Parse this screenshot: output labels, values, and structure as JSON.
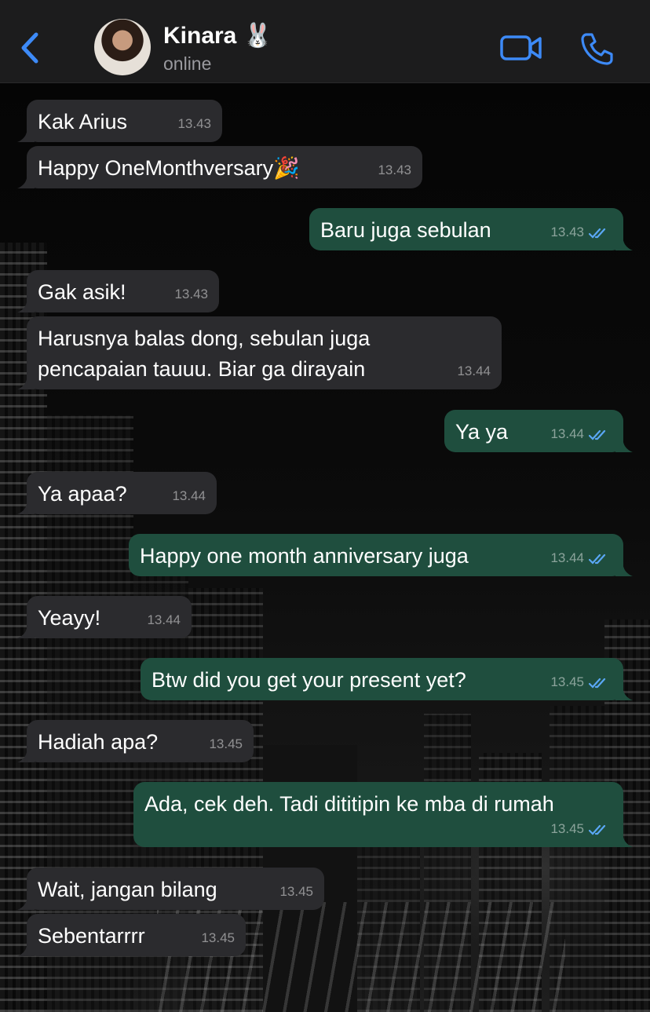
{
  "header": {
    "contact_name": "Kinara",
    "contact_emoji": "🐰",
    "status": "online"
  },
  "colors": {
    "accent": "#3d8af7",
    "incoming_bubble": "#2b2b2e",
    "outgoing_bubble": "#1f4e3e",
    "read_tick": "#5aa7f5"
  },
  "messages": [
    {
      "dir": "in",
      "text": "Kak Arius",
      "time": "13.43"
    },
    {
      "dir": "in",
      "text": "Happy OneMonthversary🎉",
      "time": "13.43"
    },
    {
      "dir": "out",
      "text": "Baru juga sebulan",
      "time": "13.43",
      "read": true
    },
    {
      "dir": "in",
      "text": "Gak asik!",
      "time": "13.43"
    },
    {
      "dir": "in",
      "text": "Harusnya balas dong, sebulan juga\npencapaian tauuu. Biar ga dirayain",
      "time": "13.44"
    },
    {
      "dir": "out",
      "text": "Ya ya",
      "time": "13.44",
      "read": true
    },
    {
      "dir": "in",
      "text": "Ya apaa?",
      "time": "13.44"
    },
    {
      "dir": "out",
      "text": "Happy one month anniversary juga",
      "time": "13.44",
      "read": true
    },
    {
      "dir": "in",
      "text": "Yeayy!",
      "time": "13.44"
    },
    {
      "dir": "out",
      "text": "Btw did you get your present yet?",
      "time": "13.45",
      "read": true
    },
    {
      "dir": "in",
      "text": "Hadiah apa?",
      "time": "13.45"
    },
    {
      "dir": "out",
      "text": "Ada, cek deh. Tadi dititipin ke mba di rumah",
      "time": "13.45",
      "read": true
    },
    {
      "dir": "in",
      "text": "Wait, jangan bilang",
      "time": "13.45"
    },
    {
      "dir": "in",
      "text": "Sebentarrrr",
      "time": "13.45"
    }
  ]
}
